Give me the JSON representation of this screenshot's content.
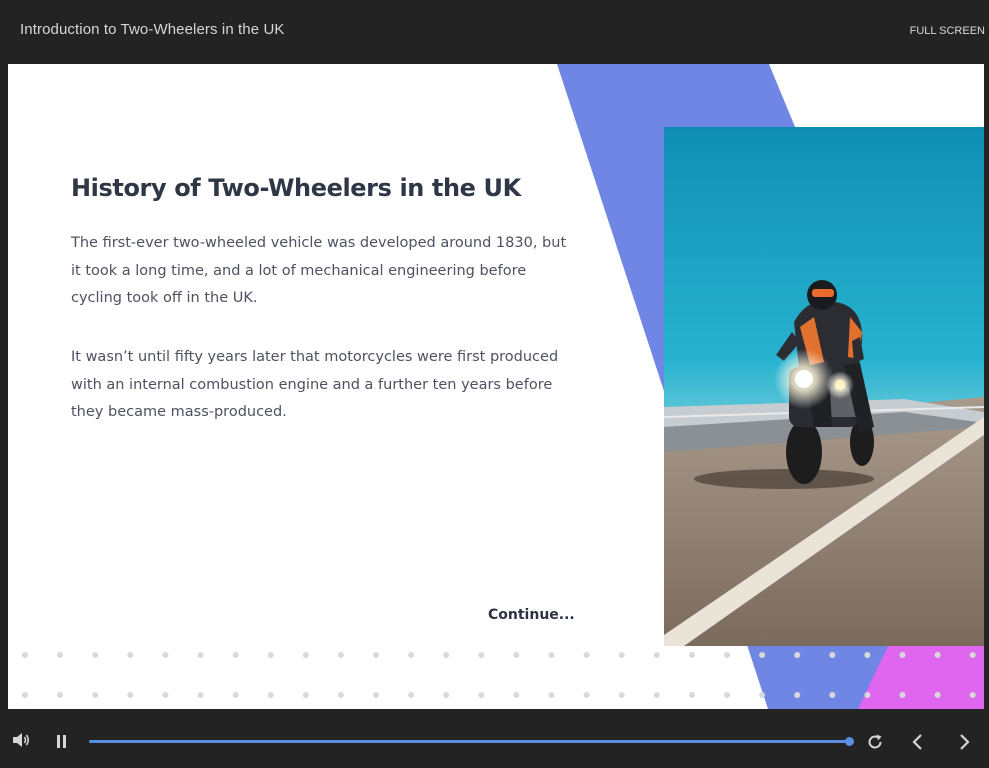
{
  "header": {
    "title": "Introduction to Two-Wheelers in the UK",
    "fullscreen_label": "FULL SCREEN"
  },
  "slide": {
    "heading": "History of Two-Wheelers in the UK",
    "paragraphs": [
      "The first-ever two-wheeled vehicle was developed around 1830, but it took a long time, and a lot of mechanical engineering before cycling took off in the UK.",
      "It wasn’t until fifty years later that motorcycles were first produced with an internal combustion engine and a further ten years before they became mass-produced."
    ],
    "continue_label": "Continue...",
    "image": "motorcyclist-on-bridge-photo",
    "accent_colors": {
      "blue": "#6f86e4",
      "magenta": "#e066f0",
      "dots": "#d9d9d9"
    }
  },
  "player": {
    "progress": 1.0,
    "icons": {
      "volume": "volume-icon",
      "pause": "pause-icon",
      "replay": "replay-icon",
      "prev": "chevron-left-icon",
      "next": "chevron-right-icon"
    }
  }
}
